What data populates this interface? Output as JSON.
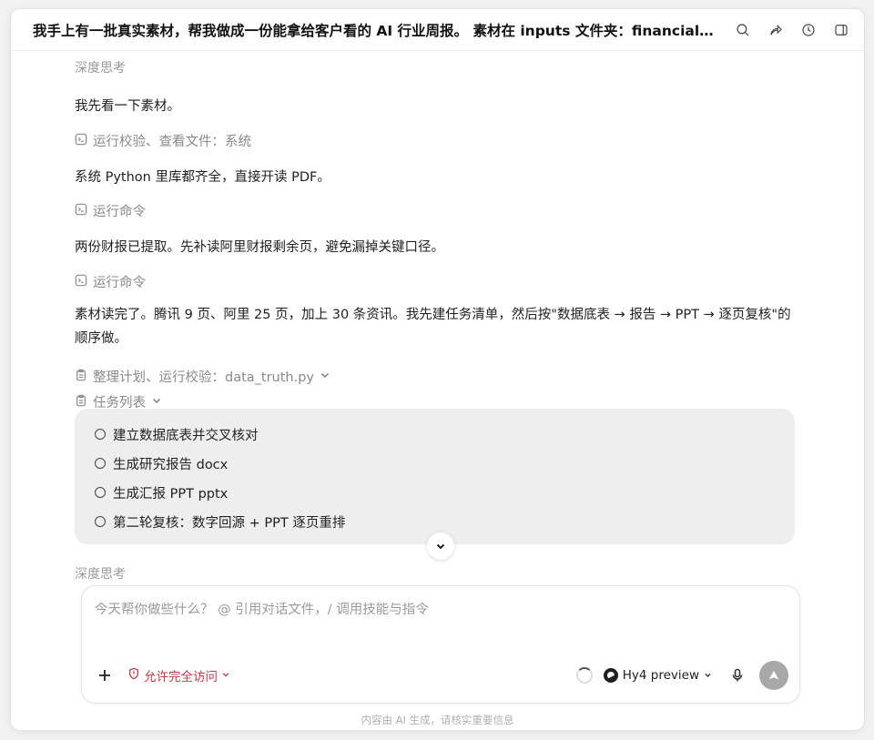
{
  "header": {
    "title": "我手上有一批真实素材，帮我做成一份能拿给客户看的 AI 行业周报。 素材在 inputs 文件夹：financials..."
  },
  "icons": {
    "search": "search-icon",
    "share": "share-icon",
    "history": "clock-icon",
    "sidebar": "sidebar-icon"
  },
  "conversation": {
    "thinking_top": "深度思考",
    "msg1": "我先看一下素材。",
    "step1": "运行校验、查看文件：系统",
    "msg2": "系统 Python 里库都齐全，直接开读 PDF。",
    "step2": "运行命令",
    "msg3": "两份财报已提取。先补读阿里财报剩余页，避免漏掉关键口径。",
    "step3": "运行命令",
    "msg4": "素材读完了。腾讯 9 页、阿里 25 页，加上 30 条资讯。我先建任务清单，然后按\"数据底表 → 报告 → PPT → 逐页复核\"的顺序做。",
    "step4": "整理计划、运行校验：data_truth.py",
    "step5": "任务列表",
    "tasks": [
      "建立数据底表并交叉核对",
      "生成研究报告 docx",
      "生成汇报 PPT pptx",
      "第二轮复核：数字回源 + PPT 逐页重排"
    ],
    "thinking_bottom": "深度思考"
  },
  "composer": {
    "placeholder": "今天帮你做些什么？ @ 引用对话文件，/ 调用技能与指令",
    "value": "",
    "access_label": "允许完全访问",
    "model_label": "Hy4 preview"
  },
  "footer": {
    "disclaimer": "内容由 AI 生成，请核实重要信息"
  },
  "colors": {
    "access": "#c0394b",
    "task_panel": "#eeeeee",
    "send_button": "#a8a8a8"
  }
}
